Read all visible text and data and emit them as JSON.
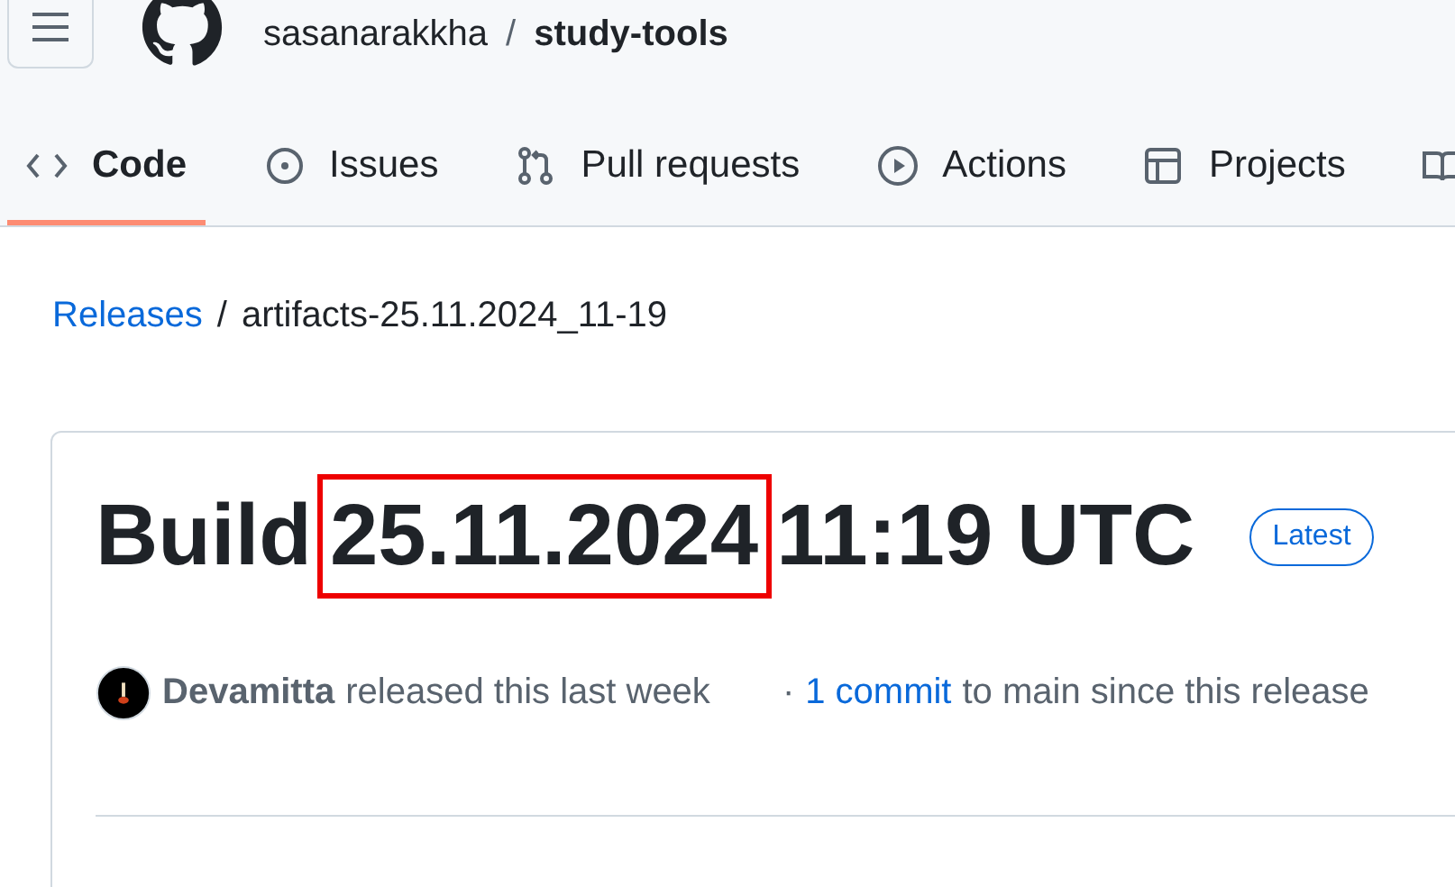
{
  "header": {
    "owner": "sasanarakkha",
    "separator": "/",
    "repo": "study-tools"
  },
  "tabs": [
    {
      "label": "Code",
      "kind": "code",
      "selected": true
    },
    {
      "label": "Issues",
      "kind": "issue",
      "selected": false
    },
    {
      "label": "Pull requests",
      "kind": "pull",
      "selected": false
    },
    {
      "label": "Actions",
      "kind": "play",
      "selected": false
    },
    {
      "label": "Projects",
      "kind": "table",
      "selected": false
    },
    {
      "kind": "book",
      "selected": false
    }
  ],
  "breadcrumb": {
    "link": "Releases",
    "separator": "/",
    "current": "artifacts-25.11.2024_11-19"
  },
  "release": {
    "title_parts": [
      {
        "text": "Build",
        "highlighted": false
      },
      {
        "text": "25.11.2024",
        "highlighted": true
      },
      {
        "text": "11:19 UTC",
        "highlighted": false
      }
    ],
    "badge": "Latest",
    "author": "Devamitta",
    "released": "released this last week",
    "dot": "·",
    "commits_link": "1 commit",
    "commits_text": "to main since this release"
  }
}
